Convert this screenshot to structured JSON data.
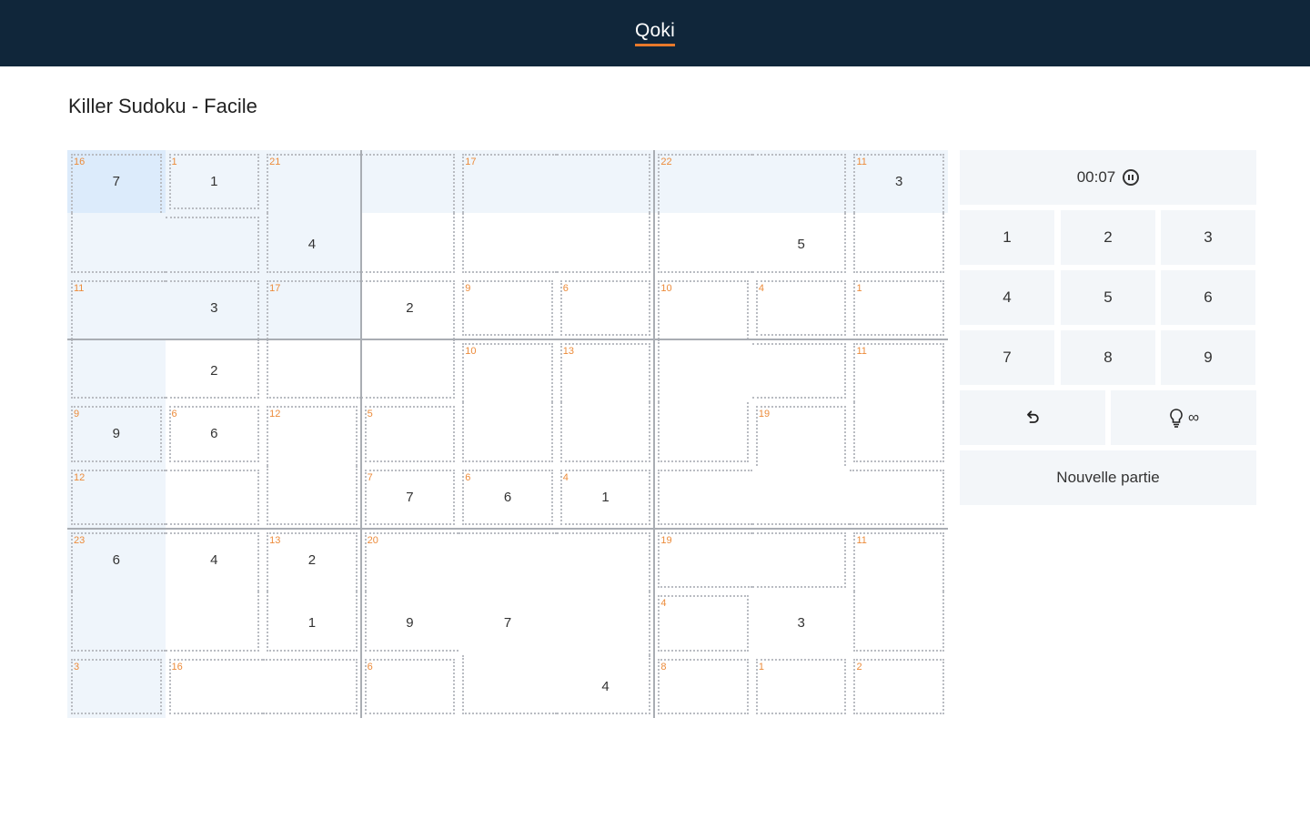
{
  "header": {
    "brand": "Qoki"
  },
  "page": {
    "title": "Killer Sudoku - Facile"
  },
  "colors": {
    "topbar": "#10263a",
    "accent": "#e8792b",
    "cage_sum": "#ec8b3a",
    "highlight": "#eff5fb",
    "selected": "#dcebfb",
    "panel": "#f3f6f9"
  },
  "board": {
    "selected_cell": [
      0,
      0
    ],
    "values": [
      [
        "7",
        "1",
        "",
        "",
        "",
        "",
        "",
        "",
        "3"
      ],
      [
        "",
        "",
        "4",
        "",
        "",
        "",
        "",
        "5",
        ""
      ],
      [
        "",
        "3",
        "",
        "2",
        "",
        "",
        "",
        "",
        ""
      ],
      [
        "",
        "2",
        "",
        "",
        "",
        "",
        "",
        "",
        ""
      ],
      [
        "9",
        "6",
        "",
        "",
        "",
        "",
        "",
        "",
        ""
      ],
      [
        "",
        "",
        "",
        "7",
        "6",
        "1",
        "",
        "",
        ""
      ],
      [
        "6",
        "4",
        "2",
        "",
        "",
        "",
        "",
        "",
        ""
      ],
      [
        "",
        "",
        "1",
        "9",
        "7",
        "",
        "",
        "3",
        ""
      ],
      [
        "",
        "",
        "",
        "",
        "",
        "4",
        "",
        "",
        ""
      ]
    ],
    "cages": [
      {
        "sum": "16",
        "cells": [
          [
            0,
            0
          ],
          [
            1,
            0
          ],
          [
            1,
            1
          ]
        ]
      },
      {
        "sum": "1",
        "cells": [
          [
            0,
            1
          ]
        ]
      },
      {
        "sum": "21",
        "cells": [
          [
            0,
            2
          ],
          [
            0,
            3
          ],
          [
            1,
            2
          ],
          [
            1,
            3
          ]
        ]
      },
      {
        "sum": "17",
        "cells": [
          [
            0,
            4
          ],
          [
            0,
            5
          ],
          [
            1,
            4
          ],
          [
            1,
            5
          ]
        ]
      },
      {
        "sum": "22",
        "cells": [
          [
            0,
            6
          ],
          [
            0,
            7
          ],
          [
            1,
            6
          ],
          [
            1,
            7
          ]
        ]
      },
      {
        "sum": "11",
        "cells": [
          [
            0,
            8
          ],
          [
            1,
            8
          ]
        ]
      },
      {
        "sum": "11",
        "cells": [
          [
            2,
            0
          ],
          [
            2,
            1
          ],
          [
            3,
            0
          ],
          [
            3,
            1
          ]
        ]
      },
      {
        "sum": "17",
        "cells": [
          [
            2,
            2
          ],
          [
            2,
            3
          ],
          [
            3,
            2
          ],
          [
            3,
            3
          ]
        ]
      },
      {
        "sum": "9",
        "cells": [
          [
            2,
            4
          ]
        ]
      },
      {
        "sum": "6",
        "cells": [
          [
            2,
            5
          ]
        ]
      },
      {
        "sum": "10",
        "cells": [
          [
            2,
            6
          ],
          [
            3,
            6
          ],
          [
            3,
            7
          ],
          [
            4,
            6
          ]
        ]
      },
      {
        "sum": "4",
        "cells": [
          [
            2,
            7
          ]
        ]
      },
      {
        "sum": "1",
        "cells": [
          [
            2,
            8
          ]
        ]
      },
      {
        "sum": "10",
        "cells": [
          [
            3,
            4
          ],
          [
            4,
            4
          ]
        ]
      },
      {
        "sum": "13",
        "cells": [
          [
            3,
            5
          ],
          [
            4,
            5
          ]
        ]
      },
      {
        "sum": "11",
        "cells": [
          [
            3,
            8
          ],
          [
            4,
            8
          ]
        ]
      },
      {
        "sum": "9",
        "cells": [
          [
            4,
            0
          ]
        ]
      },
      {
        "sum": "6",
        "cells": [
          [
            4,
            1
          ]
        ]
      },
      {
        "sum": "12",
        "cells": [
          [
            4,
            2
          ],
          [
            5,
            2
          ]
        ]
      },
      {
        "sum": "5",
        "cells": [
          [
            4,
            3
          ]
        ]
      },
      {
        "sum": "19",
        "cells": [
          [
            4,
            7
          ],
          [
            5,
            6
          ],
          [
            5,
            7
          ],
          [
            5,
            8
          ]
        ]
      },
      {
        "sum": "12",
        "cells": [
          [
            5,
            0
          ],
          [
            5,
            1
          ]
        ]
      },
      {
        "sum": "7",
        "cells": [
          [
            5,
            3
          ]
        ]
      },
      {
        "sum": "6",
        "cells": [
          [
            5,
            4
          ]
        ]
      },
      {
        "sum": "4",
        "cells": [
          [
            5,
            5
          ]
        ]
      },
      {
        "sum": "23",
        "cells": [
          [
            6,
            0
          ],
          [
            6,
            1
          ],
          [
            7,
            0
          ],
          [
            7,
            1
          ]
        ]
      },
      {
        "sum": "13",
        "cells": [
          [
            6,
            2
          ],
          [
            7,
            2
          ]
        ]
      },
      {
        "sum": "20",
        "cells": [
          [
            6,
            3
          ],
          [
            6,
            4
          ],
          [
            6,
            5
          ],
          [
            7,
            3
          ],
          [
            7,
            4
          ],
          [
            7,
            5
          ],
          [
            8,
            4
          ],
          [
            8,
            5
          ]
        ]
      },
      {
        "sum": "19",
        "cells": [
          [
            6,
            6
          ],
          [
            6,
            7
          ]
        ]
      },
      {
        "sum": "11",
        "cells": [
          [
            6,
            8
          ],
          [
            7,
            8
          ]
        ]
      },
      {
        "sum": "4",
        "cells": [
          [
            7,
            6
          ]
        ]
      },
      {
        "sum": "3",
        "cells": [
          [
            8,
            0
          ]
        ]
      },
      {
        "sum": "16",
        "cells": [
          [
            8,
            1
          ],
          [
            8,
            2
          ]
        ]
      },
      {
        "sum": "6",
        "cells": [
          [
            8,
            3
          ]
        ]
      },
      {
        "sum": "8",
        "cells": [
          [
            8,
            6
          ]
        ]
      },
      {
        "sum": "1",
        "cells": [
          [
            8,
            7
          ]
        ]
      },
      {
        "sum": "2",
        "cells": [
          [
            8,
            8
          ]
        ]
      }
    ]
  },
  "timer": {
    "time": "00:07",
    "icon": "pause-circle-icon"
  },
  "keypad": {
    "keys": [
      "1",
      "2",
      "3",
      "4",
      "5",
      "6",
      "7",
      "8",
      "9"
    ]
  },
  "controls": {
    "undo_icon": "undo-icon",
    "hint_icon": "lightbulb-icon",
    "hint_count": "∞",
    "new_game_label": "Nouvelle partie"
  }
}
